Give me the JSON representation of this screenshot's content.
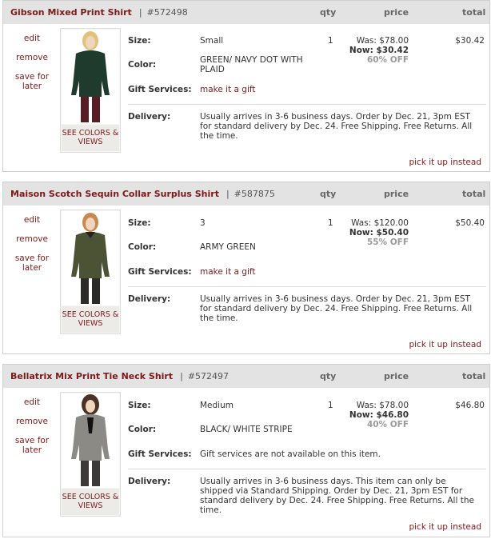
{
  "columns": {
    "qty": "qty",
    "price": "price",
    "total": "total"
  },
  "labels": {
    "size": "Size:",
    "color": "Color:",
    "gift": "Gift Services:",
    "delivery": "Delivery:",
    "edit": "edit",
    "remove": "remove",
    "save_for_later": "save for later",
    "see_colors": "SEE COLORS & VIEWS",
    "pickup": "pick it up instead",
    "separator": "|"
  },
  "items": [
    {
      "name": "Gibson Mixed Print Shirt",
      "sku": "#572498",
      "size": "Small",
      "color": "GREEN/ NAVY DOT WITH PLAID",
      "gift": "make it a gift",
      "qty": "1",
      "was": "Was: $78.00",
      "now": "Now: $30.42",
      "off": "60% OFF",
      "total": "$30.42",
      "delivery": "Usually arrives in 3-6 business days. Order by Dec. 21, 3pm EST for standard delivery by Dec. 24. Free Shipping. Free Returns. All the time."
    },
    {
      "name": "Maison Scotch Sequin Collar Surplus Shirt",
      "sku": "#587875",
      "size": "3",
      "color": "ARMY GREEN",
      "gift": "make it a gift",
      "qty": "1",
      "was": "Was: $120.00",
      "now": "Now: $50.40",
      "off": "55% OFF",
      "total": "$50.40",
      "delivery": "Usually arrives in 3-6 business days. Order by Dec. 21, 3pm EST for standard delivery by Dec. 24. Free Shipping. Free Returns. All the time."
    },
    {
      "name": "Bellatrix Mix Print Tie Neck Shirt",
      "sku": "#572497",
      "size": "Medium",
      "color": "BLACK/ WHITE STRIPE",
      "gift": "Gift services are not available on this item.",
      "qty": "1",
      "was": "Was: $78.00",
      "now": "Now: $46.80",
      "off": "40% OFF",
      "total": "$46.80",
      "delivery": "Usually arrives in 3-6 business days. This item can only be shipped via Standard Shipping. Order by Dec. 21, 3pm EST for standard delivery by Dec. 24. Free Shipping. Free Returns. All the time."
    }
  ]
}
